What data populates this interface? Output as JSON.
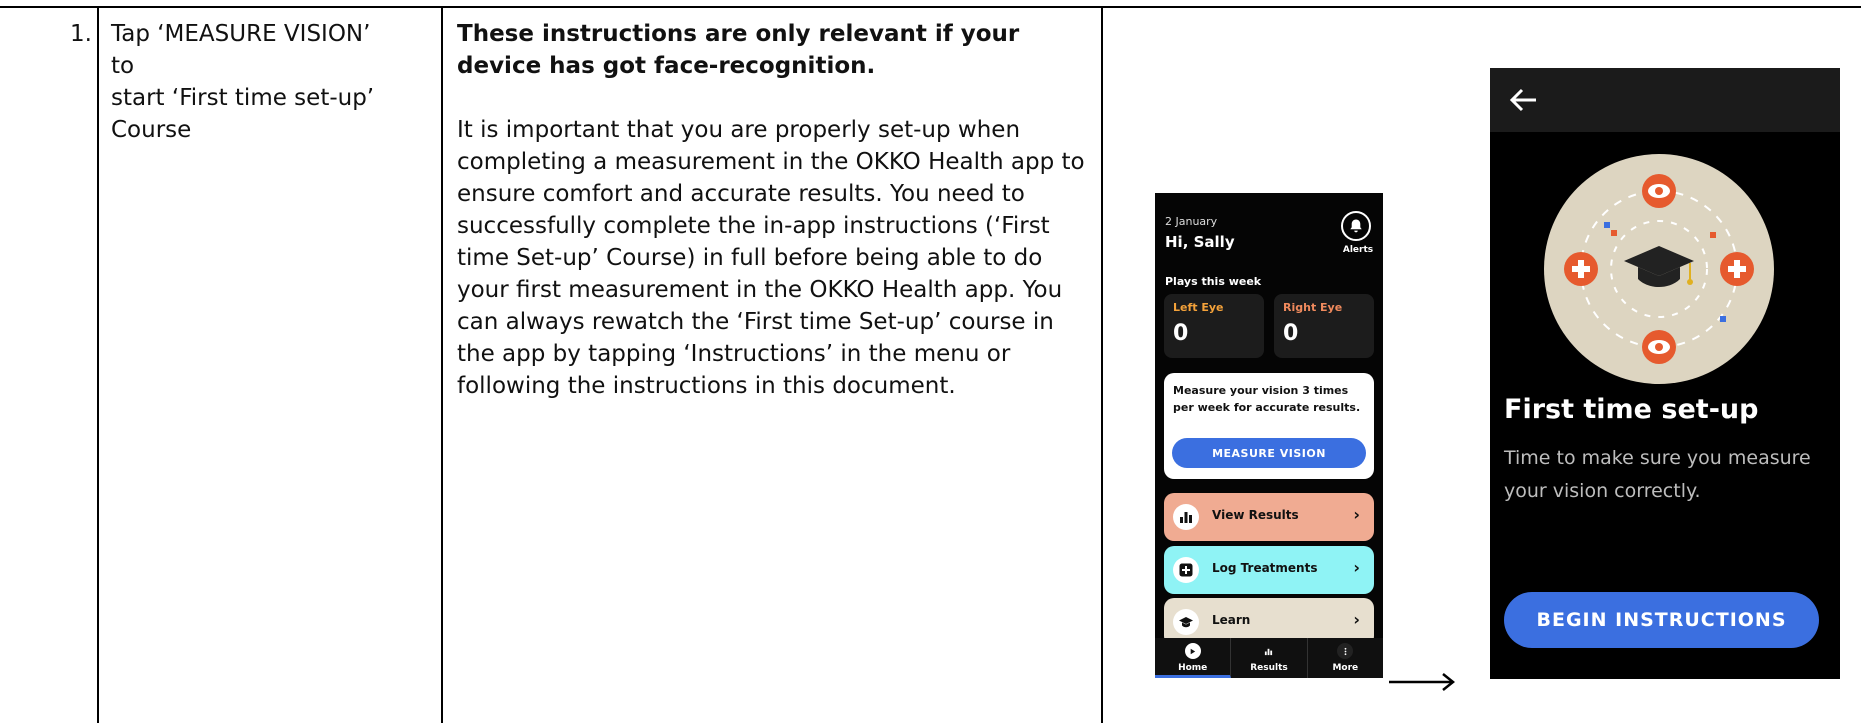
{
  "row": {
    "number": "1.",
    "instruction": [
      "Tap ‘MEASURE VISION’",
      "to",
      "start ‘First time set-up’",
      "Course"
    ],
    "bold_text": "These instructions are only relevant if your device has got face-recognition.",
    "body_text": "It is important that you are properly set-up when completing a measurement in the OKKO Health app to ensure comfort and accurate results. You need to successfully complete the in-app instructions (‘First time Set-up’ Course) in full before being able to do your first measurement in the OKKO Health app. You can always rewatch the ‘First time Set-up’ course in the app by tapping ‘Instructions’ in the menu or following the instructions in this document."
  },
  "home_screen": {
    "date": "2 January",
    "greeting": "Hi, Sally",
    "alerts_label": "Alerts",
    "plays_label": "Plays this week",
    "left_eye_label": "Left Eye",
    "left_eye_value": "0",
    "right_eye_label": "Right Eye",
    "right_eye_value": "0",
    "measure_message": "Measure your vision 3 times per week for accurate results.",
    "measure_button": "MEASURE VISION",
    "menu": [
      {
        "label": "View Results",
        "color": "#f0ab92"
      },
      {
        "label": "Log Treatments",
        "color": "#8ff3f5"
      },
      {
        "label": "Learn",
        "color": "#e7dfcf"
      }
    ],
    "nav": [
      "Home",
      "Results",
      "More"
    ]
  },
  "setup_screen": {
    "title": "First time set-up",
    "subtitle": "Time to make sure you measure your vision correctly.",
    "button": "BEGIN INSTRUCTIONS"
  },
  "colors": {
    "accent_blue": "#3b6fe0",
    "left_eye": "#f4a23a",
    "right_eye": "#f08a5d",
    "illustration_bg": "#ddd5c1",
    "eye_orange": "#e65a2e"
  }
}
